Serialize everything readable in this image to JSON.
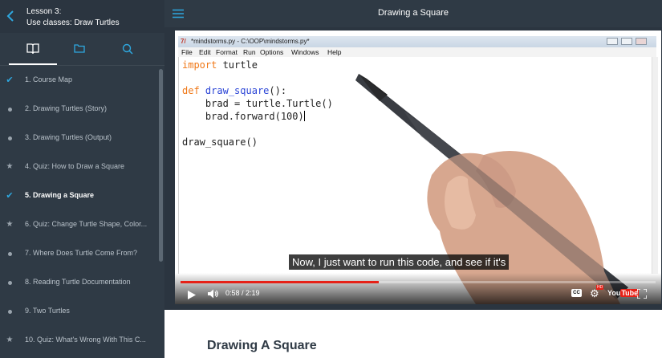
{
  "sidebar": {
    "lesson_number": "Lesson 3:",
    "lesson_title": "Use classes: Draw Turtles",
    "tabs": [
      "lessons-book-icon",
      "resources-folder-icon",
      "search-icon"
    ],
    "items": [
      {
        "label": "1. Course Map",
        "marker": "check"
      },
      {
        "label": "2. Drawing Turtles (Story)",
        "marker": "dot"
      },
      {
        "label": "3. Drawing Turtles (Output)",
        "marker": "dot"
      },
      {
        "label": "4. Quiz: How to Draw a Square",
        "marker": "star"
      },
      {
        "label": "5. Drawing a Square",
        "marker": "check",
        "current": true
      },
      {
        "label": "6. Quiz: Change Turtle Shape, Color...",
        "marker": "star"
      },
      {
        "label": "7. Where Does Turtle Come From?",
        "marker": "dot"
      },
      {
        "label": "8. Reading Turtle Documentation",
        "marker": "dot"
      },
      {
        "label": "9. Two Turtles",
        "marker": "dot"
      },
      {
        "label": "10. Quiz: What's Wrong With This C...",
        "marker": "star"
      }
    ]
  },
  "header": {
    "title": "Drawing a Square"
  },
  "video": {
    "idle_title": "*mindstorms.py - C:\\OOP\\mindstorms.py*",
    "idle_menu": [
      "File",
      "Edit",
      "Format",
      "Run",
      "Options",
      "Windows",
      "Help"
    ],
    "code": {
      "import_kw": "import",
      "import_mod": " turtle",
      "def_kw": "def",
      "func_name": "draw_square",
      "def_rest": "():",
      "line_brad": "    brad = turtle.Turtle()",
      "line_forward": "    brad.forward(100)",
      "call": "draw_square()"
    },
    "caption": "Now, I just want to run this code, and see if it's",
    "time_current": "0:58",
    "time_total": "2:19",
    "time_text": "0:58 / 2:19",
    "progress_fraction": 0.417,
    "cc_label": "CC",
    "hd_label": "HD",
    "yt_you": "You",
    "yt_tube": "Tube"
  },
  "content": {
    "heading": "Drawing A Square"
  },
  "colors": {
    "sidebar_bg": "#2f3a45",
    "accent": "#2ea8e0",
    "progress": "#e62117",
    "keyword": "#f07817",
    "function": "#2a44d6"
  }
}
